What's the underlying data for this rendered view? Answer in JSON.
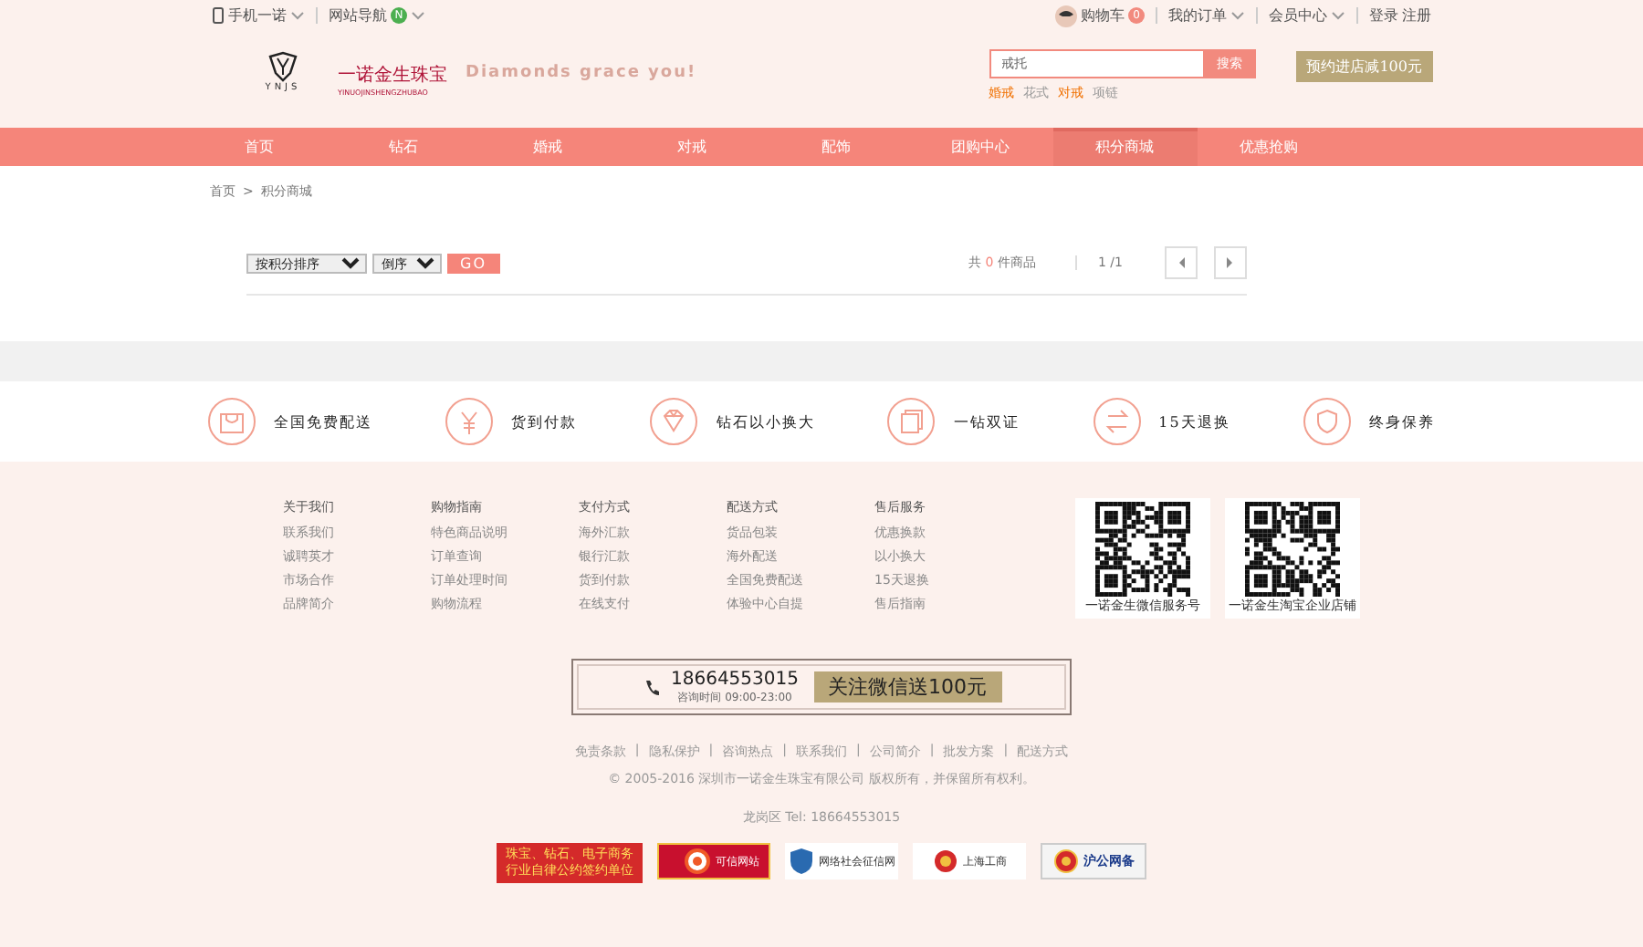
{
  "top_bar": {
    "left": [
      {
        "label": "手机一诺"
      },
      {
        "label": "网站导航",
        "badge": "N"
      }
    ],
    "cart": {
      "label": "购物车",
      "count": "0"
    },
    "right": [
      "我的订单",
      "会员中心"
    ],
    "auth": [
      "登录",
      "注册"
    ]
  },
  "header": {
    "logo_mark": "YNJS",
    "brand": "一诺金生珠宝",
    "brand_pinyin": "YINUOJINSHENGZHUBAO",
    "slogan": "Diamonds grace you!",
    "search": {
      "value": "戒托",
      "button": "搜索"
    },
    "hot_words": [
      {
        "label": "婚戒",
        "highlight": true
      },
      {
        "label": "花式",
        "highlight": false
      },
      {
        "label": "对戒",
        "highlight": true
      },
      {
        "label": "项链",
        "highlight": false
      }
    ],
    "promo_button": "预约进店减100元"
  },
  "nav": [
    {
      "label": "首页",
      "selected": false
    },
    {
      "label": "钻石",
      "selected": false
    },
    {
      "label": "婚戒",
      "selected": false
    },
    {
      "label": "对戒",
      "selected": false
    },
    {
      "label": "配饰",
      "selected": false
    },
    {
      "label": "团购中心",
      "selected": false
    },
    {
      "label": "积分商城",
      "selected": true
    },
    {
      "label": "优惠抢购",
      "selected": false
    }
  ],
  "breadcrumb": {
    "items": [
      "首页",
      "积分商城"
    ],
    "separator": ">"
  },
  "toolbar": {
    "sort": "按积分排序",
    "order": "倒序",
    "go": "GO",
    "count_prefix": "共",
    "count": "0",
    "count_suffix": "件商品",
    "pages": "1 /1"
  },
  "features": [
    {
      "kind": "bag",
      "label": "全国免费配送"
    },
    {
      "kind": "yen",
      "label": "货到付款"
    },
    {
      "kind": "diamond",
      "label": "钻石以小换大"
    },
    {
      "kind": "cards",
      "label": "一钻双证"
    },
    {
      "kind": "swap",
      "label": "15天退换"
    },
    {
      "kind": "shield",
      "label": "终身保养"
    }
  ],
  "footer": {
    "columns": [
      {
        "title": "关于我们",
        "links": [
          "联系我们",
          "诚聘英才",
          "市场合作",
          "品牌简介"
        ]
      },
      {
        "title": "购物指南",
        "links": [
          "特色商品说明",
          "订单查询",
          "订单处理时间",
          "购物流程"
        ]
      },
      {
        "title": "支付方式",
        "links": [
          "海外汇款",
          "银行汇款",
          "货到付款",
          "在线支付"
        ]
      },
      {
        "title": "配送方式",
        "links": [
          "货品包装",
          "海外配送",
          "全国免费配送",
          "体验中心自提"
        ]
      },
      {
        "title": "售后服务",
        "links": [
          "优惠换款",
          "以小换大",
          "15天退换",
          "售后指南"
        ]
      }
    ],
    "qr_codes": [
      "一诺金生微信服务号",
      "一诺金生淘宝企业店铺"
    ],
    "contact": {
      "phone": "18664553015",
      "hours": "咨询时间 09:00-23:00",
      "wechat": "关注微信送100元"
    },
    "links": [
      "免责条款",
      "隐私保护",
      "咨询热点",
      "联系我们",
      "公司简介",
      "批发方案",
      "配送方式"
    ],
    "link_separator": "|",
    "copyright": "© 2005-2016 深圳市一诺金生珠宝有限公司 版权所有，并保留所有权利。",
    "address": "龙岗区 Tel: 18664553015",
    "certs": [
      {
        "kind": "pact",
        "label": "珠宝、钻石、电子商务行业自律公约签约单位"
      },
      {
        "kind": "trusted",
        "label": "可信网站"
      },
      {
        "kind": "credit",
        "label": "网络社会征信网"
      },
      {
        "kind": "aic",
        "label": "上海工商"
      },
      {
        "kind": "police",
        "label": "沪公网备"
      }
    ]
  }
}
